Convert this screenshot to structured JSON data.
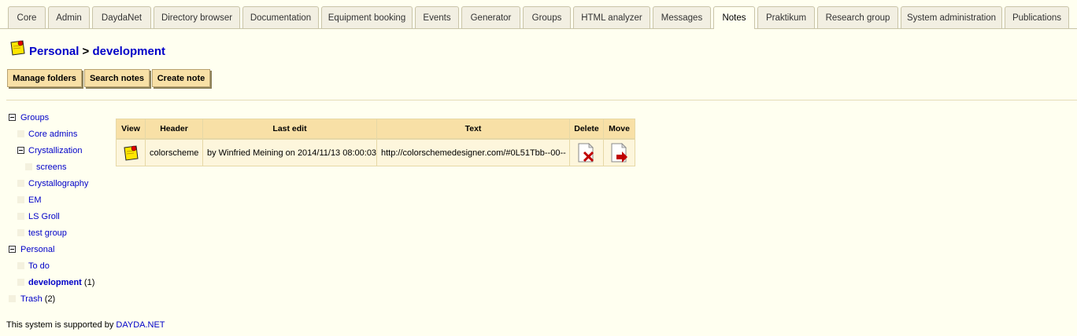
{
  "tabs": [
    {
      "label": "Core"
    },
    {
      "label": "Admin"
    },
    {
      "label": "DaydaNet"
    },
    {
      "label": "Directory browser"
    },
    {
      "label": "Documentation"
    },
    {
      "label": "Equipment booking"
    },
    {
      "label": "Events"
    },
    {
      "label": "Generator"
    },
    {
      "label": "Groups"
    },
    {
      "label": "HTML analyzer"
    },
    {
      "label": "Messages"
    },
    {
      "label": "Notes",
      "active": true
    },
    {
      "label": "Praktikum"
    },
    {
      "label": "Research group"
    },
    {
      "label": "System administration"
    },
    {
      "label": "Publications"
    }
  ],
  "breadcrumb": {
    "root": "Personal",
    "separator": ">",
    "current": "development"
  },
  "actions": {
    "manage": "Manage folders",
    "search": "Search notes",
    "create": "Create note"
  },
  "tree": {
    "groups": "Groups",
    "core_admins": "Core admins",
    "crystallization": "Crystallization",
    "screens": "screens",
    "crystallography": "Crystallography",
    "em": "EM",
    "ls_groll": "LS Groll",
    "test_group": "test group",
    "personal": "Personal",
    "todo": "To do",
    "development": "development",
    "development_count": "(1)",
    "trash": "Trash",
    "trash_count": "(2)"
  },
  "table": {
    "headers": {
      "view": "View",
      "header": "Header",
      "last_edit": "Last edit",
      "text": "Text",
      "delete": "Delete",
      "move": "Move"
    },
    "rows": [
      {
        "header": "colorscheme",
        "last_edit": "by Winfried Meining on 2014/11/13 08:00:03",
        "text": "http://colorschemedesigner.com/#0L51Tbb--00--"
      }
    ]
  },
  "footer": {
    "text": "This system is supported by ",
    "link": "DAYDA.NET"
  },
  "colors": {
    "background": "#fffff0",
    "link": "#0000c8",
    "button": "#f8e0a6",
    "note_icon": "#ffe600"
  },
  "icons": {
    "note": "note-pin-icon",
    "delete": "delete-doc-icon",
    "move": "move-doc-icon"
  }
}
